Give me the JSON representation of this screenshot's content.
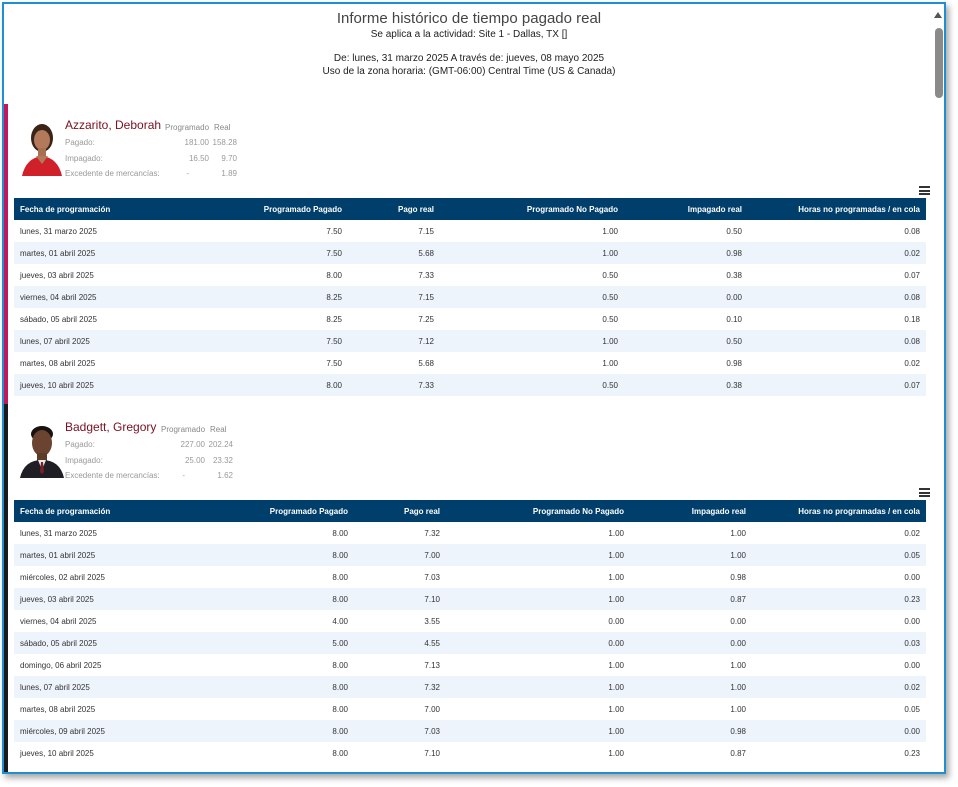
{
  "report": {
    "title": "Informe histórico de tiempo pagado real",
    "activity": "Se aplica a la actividad: Site 1 - Dallas, TX []",
    "range": "De: lunes, 31 marzo 2025 A través de: jueves, 08 mayo 2025",
    "timezone": "Uso de la zona horaria: (GMT-06:00) Central Time (US & Canada)"
  },
  "columns": [
    "Fecha de programación",
    "Programado Pagado",
    "Pago real",
    "Programado No Pagado",
    "Impagado real",
    "Horas no programadas / en cola"
  ],
  "summary_headers": {
    "scheduled": "Programado",
    "actual": "Real"
  },
  "summary_labels": {
    "paid": "Pagado:",
    "unpaid": "Impagado:",
    "surplus": "Excedente de mercancías:"
  },
  "employees": [
    {
      "name": "Azzarito, Deborah",
      "paid": [
        "181.00",
        "158.28"
      ],
      "unpaid": [
        "16.50",
        "9.70"
      ],
      "surplus": [
        "-",
        "1.89"
      ],
      "rows": [
        [
          "lunes, 31 marzo 2025",
          "7.50",
          "7.15",
          "1.00",
          "0.50",
          "0.08"
        ],
        [
          "martes, 01 abril 2025",
          "7.50",
          "5.68",
          "1.00",
          "0.98",
          "0.02"
        ],
        [
          "jueves, 03 abril 2025",
          "8.00",
          "7.33",
          "0.50",
          "0.38",
          "0.07"
        ],
        [
          "viernes, 04 abril 2025",
          "8.25",
          "7.15",
          "0.50",
          "0.00",
          "0.08"
        ],
        [
          "sábado, 05 abril 2025",
          "8.25",
          "7.25",
          "0.50",
          "0.10",
          "0.18"
        ],
        [
          "lunes, 07 abril 2025",
          "7.50",
          "7.12",
          "1.00",
          "0.50",
          "0.08"
        ],
        [
          "martes, 08 abril 2025",
          "7.50",
          "5.68",
          "1.00",
          "0.98",
          "0.02"
        ],
        [
          "jueves, 10 abril 2025",
          "8.00",
          "7.33",
          "0.50",
          "0.38",
          "0.07"
        ]
      ]
    },
    {
      "name": "Badgett, Gregory",
      "paid": [
        "227.00",
        "202.24"
      ],
      "unpaid": [
        "25.00",
        "23.32"
      ],
      "surplus": [
        "-",
        "1.62"
      ],
      "rows": [
        [
          "lunes, 31 marzo 2025",
          "8.00",
          "7.32",
          "1.00",
          "1.00",
          "0.02"
        ],
        [
          "martes, 01 abril 2025",
          "8.00",
          "7.00",
          "1.00",
          "1.00",
          "0.05"
        ],
        [
          "miércoles, 02 abril 2025",
          "8.00",
          "7.03",
          "1.00",
          "0.98",
          "0.00"
        ],
        [
          "jueves, 03 abril 2025",
          "8.00",
          "7.10",
          "1.00",
          "0.87",
          "0.23"
        ],
        [
          "viernes, 04 abril 2025",
          "4.00",
          "3.55",
          "0.00",
          "0.00",
          "0.00"
        ],
        [
          "sábado, 05 abril 2025",
          "5.00",
          "4.55",
          "0.00",
          "0.00",
          "0.03"
        ],
        [
          "domingo, 06 abril 2025",
          "8.00",
          "7.13",
          "1.00",
          "1.00",
          "0.00"
        ],
        [
          "lunes, 07 abril 2025",
          "8.00",
          "7.32",
          "1.00",
          "1.00",
          "0.02"
        ],
        [
          "martes, 08 abril 2025",
          "8.00",
          "7.00",
          "1.00",
          "1.00",
          "0.05"
        ],
        [
          "miércoles, 09 abril 2025",
          "8.00",
          "7.03",
          "1.00",
          "0.98",
          "0.00"
        ],
        [
          "jueves, 10 abril 2025",
          "8.00",
          "7.10",
          "1.00",
          "0.87",
          "0.23"
        ]
      ]
    }
  ]
}
